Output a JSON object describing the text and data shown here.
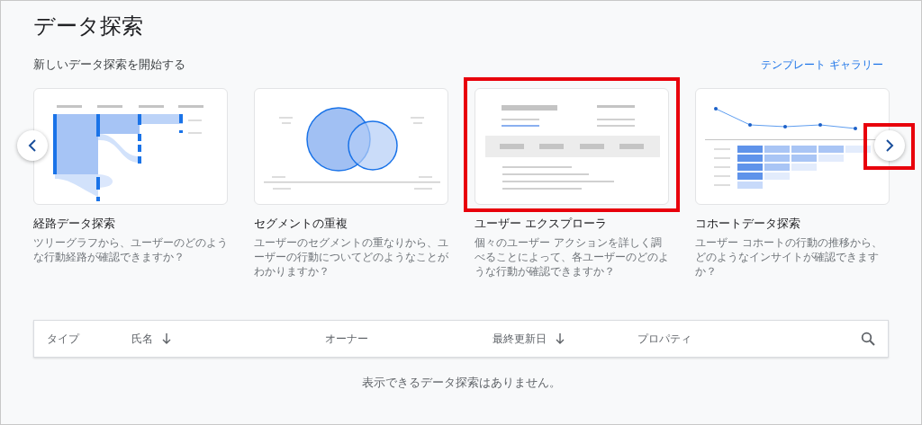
{
  "title": "データ探索",
  "section": {
    "heading": "新しいデータ探索を開始する",
    "link": "テンプレート ギャラリー"
  },
  "carousel": {
    "prev": {
      "highlighted": false
    },
    "next": {
      "highlighted": true
    }
  },
  "cards": [
    {
      "kind": "path",
      "title": "経路データ探索",
      "description": "ツリーグラフから、ユーザーのどのような行動経路が確認できますか？",
      "highlighted": false
    },
    {
      "kind": "overlap",
      "title": "セグメントの重複",
      "description": "ユーザーのセグメントの重なりから、ユーザーの行動についてどのようなことがわかりますか？",
      "highlighted": false
    },
    {
      "kind": "explorer",
      "title": "ユーザー エクスプローラ",
      "description": "個々のユーザー アクションを詳しく調べることによって、各ユーザーのどのような行動が確認できますか？",
      "highlighted": true
    },
    {
      "kind": "cohort",
      "title": "コホートデータ探索",
      "description": "ユーザー コホートの行動の推移から、どのようなインサイトが確認できますか？",
      "highlighted": false
    }
  ],
  "table": {
    "columns": [
      {
        "label": "タイプ",
        "sorted": false
      },
      {
        "label": "氏名",
        "sorted": true
      },
      {
        "label": "オーナー",
        "sorted": false
      },
      {
        "label": "最終更新日",
        "sorted": true
      },
      {
        "label": "プロパティ",
        "sorted": false
      }
    ],
    "empty_message": "表示できるデータ探索はありません。"
  }
}
